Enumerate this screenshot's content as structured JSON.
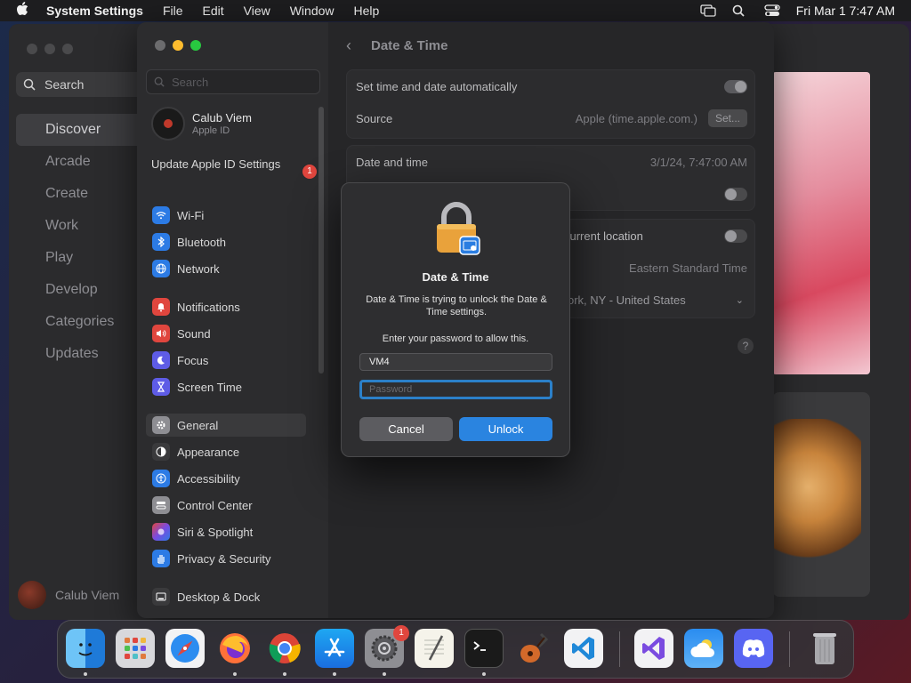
{
  "menubar": {
    "app_name": "System Settings",
    "menus": [
      "File",
      "Edit",
      "View",
      "Window",
      "Help"
    ],
    "datetime": "Fri Mar 1  7:47 AM"
  },
  "appstore": {
    "search_label": "Search",
    "nav": [
      "Discover",
      "Arcade",
      "Create",
      "Work",
      "Play",
      "Develop",
      "Categories",
      "Updates"
    ],
    "selected": "Discover",
    "user_name": "Calub Viem"
  },
  "settings": {
    "search_placeholder": "Search",
    "user": {
      "name": "Calub Viem",
      "subtitle": "Apple ID"
    },
    "update": {
      "label": "Update Apple ID Settings",
      "badge": "1"
    },
    "sidebar": [
      {
        "label": "Wi-Fi",
        "color": "#2c7be5",
        "icon": "wifi-icon"
      },
      {
        "label": "Bluetooth",
        "color": "#2c7be5",
        "icon": "bluetooth-icon"
      },
      {
        "label": "Network",
        "color": "#2c7be5",
        "icon": "globe-icon"
      },
      {
        "label": "Notifications",
        "color": "#e0463e",
        "icon": "bell-icon"
      },
      {
        "label": "Sound",
        "color": "#e0463e",
        "icon": "speaker-icon"
      },
      {
        "label": "Focus",
        "color": "#5e5ce6",
        "icon": "moon-icon"
      },
      {
        "label": "Screen Time",
        "color": "#5e5ce6",
        "icon": "hourglass-icon"
      },
      {
        "label": "General",
        "color": "#8e8e93",
        "icon": "gear-icon"
      },
      {
        "label": "Appearance",
        "color": "#3a3a3c",
        "icon": "appearance-icon"
      },
      {
        "label": "Accessibility",
        "color": "#2c7be5",
        "icon": "accessibility-icon"
      },
      {
        "label": "Control Center",
        "color": "#8e8e93",
        "icon": "control-center-icon"
      },
      {
        "label": "Siri & Spotlight",
        "color": "#7a4be0",
        "icon": "siri-icon"
      },
      {
        "label": "Privacy & Security",
        "color": "#2c7be5",
        "icon": "hand-icon"
      },
      {
        "label": "Desktop & Dock",
        "color": "#3a3a3c",
        "icon": "dock-icon"
      }
    ],
    "selected": "General",
    "page_title": "Date & Time",
    "rows": {
      "auto_label": "Set time and date automatically",
      "source_label": "Source",
      "source_value": "Apple (time.apple.com.)",
      "set_button": "Set...",
      "datetime_label": "Date and time",
      "datetime_value": "3/1/24, 7:47:00 AM",
      "location_label": "current location",
      "timezone_value": "Eastern Standard Time",
      "city_value": "ork, NY - United States"
    },
    "help": "?"
  },
  "dialog": {
    "title": "Date & Time",
    "message": "Date & Time is trying to unlock the Date & Time settings.",
    "prompt": "Enter your password to allow this.",
    "username": "VM4",
    "password_placeholder": "Password",
    "cancel": "Cancel",
    "unlock": "Unlock"
  },
  "dock": {
    "apps": [
      "finder-icon",
      "launchpad-icon",
      "safari-icon",
      "firefox-icon",
      "chrome-icon",
      "app-store-icon",
      "system-settings-icon",
      "textedit-icon",
      "terminal-icon",
      "garageband-icon",
      "vscode-icon",
      "visual-studio-icon",
      "weather-icon",
      "discord-icon",
      "trash-icon"
    ],
    "settings_badge": "1"
  }
}
